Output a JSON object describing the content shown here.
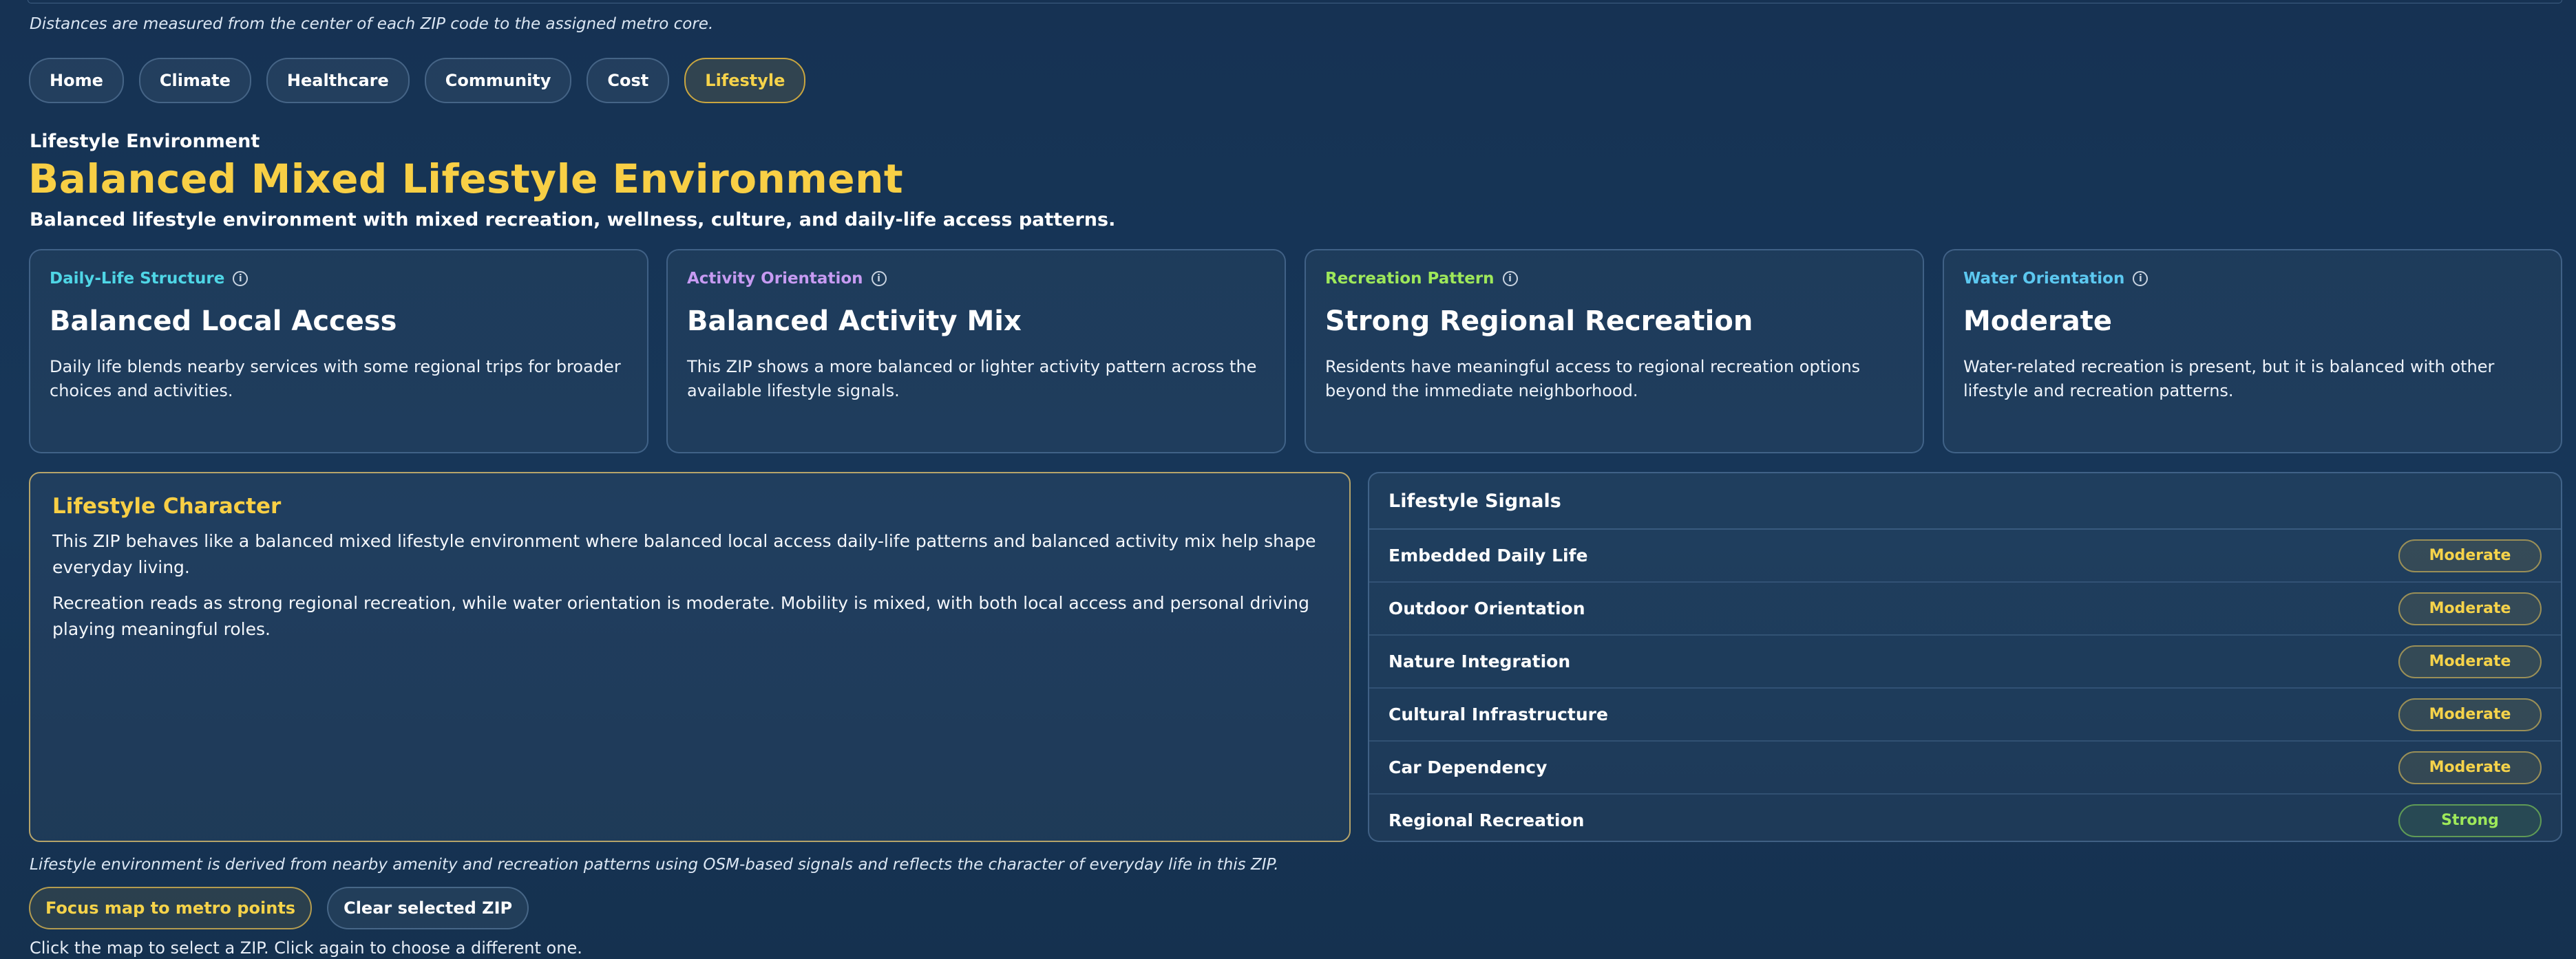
{
  "notes": {
    "distance": "Distances are measured from the center of each ZIP code to the assigned metro core.",
    "derived": "Lifestyle environment is derived from nearby amenity and recreation patterns using OSM-based signals and reflects the character of everyday life in this ZIP.",
    "hint": "Click the map to select a ZIP. Click again to choose a different one."
  },
  "tabs": [
    {
      "label": "Home"
    },
    {
      "label": "Climate"
    },
    {
      "label": "Healthcare"
    },
    {
      "label": "Community"
    },
    {
      "label": "Cost"
    },
    {
      "label": "Lifestyle",
      "active": true
    }
  ],
  "header": {
    "section": "Lifestyle Environment",
    "title": "Balanced Mixed Lifestyle Environment",
    "subtitle": "Balanced lifestyle environment with mixed recreation, wellness, culture, and daily-life access patterns."
  },
  "cards": [
    {
      "label": "Daily-Life Structure",
      "label_color": "#4fd6e6",
      "title": "Balanced Local Access",
      "desc": "Daily life blends nearby services with some regional trips for broader choices and activities."
    },
    {
      "label": "Activity Orientation",
      "label_color": "#c79bf2",
      "title": "Balanced Activity Mix",
      "desc": "This ZIP shows a more balanced or lighter activity pattern across the available lifestyle signals."
    },
    {
      "label": "Recreation Pattern",
      "label_color": "#9ee85a",
      "title": "Strong Regional Recreation",
      "desc": "Residents have meaningful access to regional recreation options beyond the immediate neighborhood."
    },
    {
      "label": "Water Orientation",
      "label_color": "#5cc8f0",
      "title": "Moderate",
      "desc": "Water-related recreation is present, but it is balanced with other lifestyle and recreation patterns."
    }
  ],
  "character": {
    "title": "Lifestyle Character",
    "p1": "This ZIP behaves like a balanced mixed lifestyle environment where balanced local access daily-life patterns and balanced activity mix help shape everyday living.",
    "p2": "Recreation reads as strong regional recreation, while water orientation is moderate. Mobility is mixed, with both local access and personal driving playing meaningful roles."
  },
  "signals": {
    "title": "Lifestyle Signals",
    "rows": [
      {
        "name": "Embedded Daily Life",
        "value": "Moderate"
      },
      {
        "name": "Outdoor Orientation",
        "value": "Moderate"
      },
      {
        "name": "Nature Integration",
        "value": "Moderate"
      },
      {
        "name": "Cultural Infrastructure",
        "value": "Moderate"
      },
      {
        "name": "Car Dependency",
        "value": "Moderate"
      },
      {
        "name": "Regional Recreation",
        "value": "Strong"
      }
    ]
  },
  "buttons": {
    "focus": "Focus map to metro points",
    "clear": "Clear selected ZIP"
  },
  "icons": {
    "info": "info-icon"
  }
}
